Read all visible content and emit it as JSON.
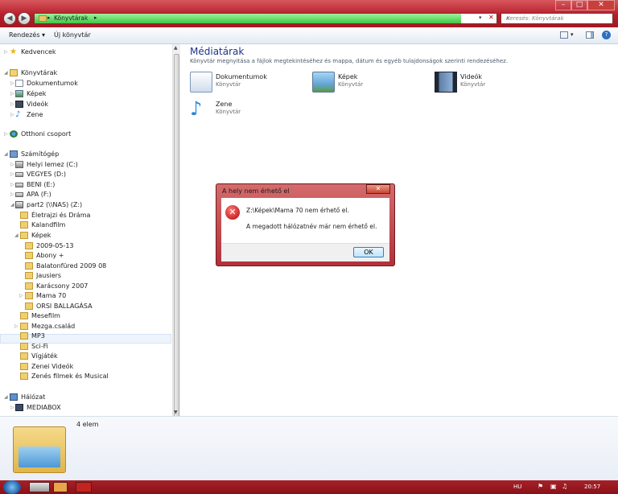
{
  "window": {
    "address_crumb": "Könyvtárak",
    "search_placeholder": "Keresés: Könyvtárak",
    "controls": {
      "minimize": "–",
      "maximize": "□",
      "close": "✕"
    }
  },
  "toolbar": {
    "organize_label": "Rendezés ▾",
    "new_library_label": "Új könyvtár"
  },
  "sidebar": {
    "favorites": "Kedvencek",
    "libraries": "Könyvtárak",
    "lib_items": [
      "Dokumentumok",
      "Képek",
      "Videók",
      "Zene"
    ],
    "homegroup": "Otthoni csoport",
    "computer": "Számítógép",
    "drives": [
      "Helyi lemez (C:)",
      "VEGYES (D:)",
      "BENI (E:)",
      "APA (F:)",
      "part2 (\\\\NAS) (Z:)"
    ],
    "z_folders": [
      "Életrajzi és Dráma",
      "Kalandfilm",
      "Képek"
    ],
    "kepek_folders": [
      "2009-05-13",
      "Abony +",
      "Balatonfüred 2009 08",
      "Jausiers",
      "Karácsony 2007",
      "Mama 70",
      "ORSI BALLAGÁSA"
    ],
    "more_folders": [
      "Mesefilm",
      "Mezga.család",
      "MP3",
      "Sci-Fi",
      "Vígjáték",
      "Zenei Videók",
      "Zenés filmek és Musical"
    ],
    "network": "Hálózat",
    "network_items": [
      "MEDIABOX"
    ]
  },
  "content": {
    "title": "Médiatárak",
    "description": "Könyvtár megnyitása a fájlok megtekintéséhez és mappa, dátum és egyéb tulajdonságok szerinti rendezéséhez.",
    "libraries": [
      {
        "name": "Dokumentumok",
        "type": "Könyvtár"
      },
      {
        "name": "Képek",
        "type": "Könyvtár"
      },
      {
        "name": "Videók",
        "type": "Könyvtár"
      },
      {
        "name": "Zene",
        "type": "Könyvtár"
      }
    ]
  },
  "details": {
    "count": "4 elem"
  },
  "dialog": {
    "title": "A hely nem érhető el",
    "line1": "Z:\\Képek\\Mama 70 nem érhető el.",
    "line2": "A megadott hálózatnév már nem érhető el.",
    "ok_label": "OK"
  },
  "taskbar": {
    "language": "HU",
    "clock": "20:57"
  },
  "colors": {
    "titlebar": "#b61d2a",
    "selection": "#eef4fb",
    "link_title": "#1e3287",
    "error_icon": "#c8262b"
  }
}
